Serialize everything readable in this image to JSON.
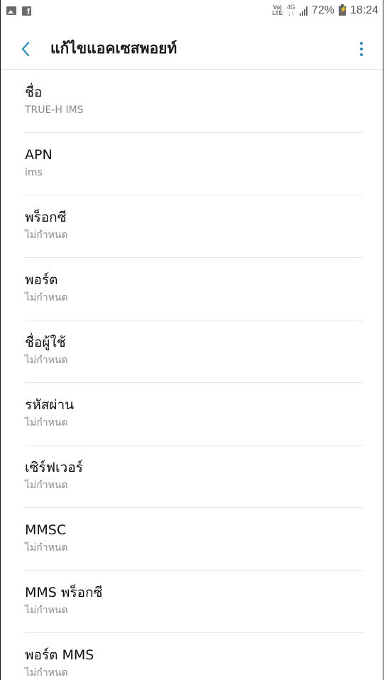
{
  "status_bar": {
    "volte_top": "Vo)",
    "volte_bottom": "LTE",
    "net_top": "4G",
    "net_bottom": "↓↑",
    "battery_percent": "72%",
    "time": "18:24",
    "left_icons": [
      "gallery-icon",
      "facebook-icon"
    ]
  },
  "toolbar": {
    "back_icon": "chevron-left-icon",
    "title": "แก้ไขแอคเซสพอยท์",
    "menu_icon": "more-vertical-icon",
    "accent_color": "#2e8bbd"
  },
  "fields": [
    {
      "key": "name",
      "label": "ชื่อ",
      "value": "TRUE-H IMS"
    },
    {
      "key": "apn",
      "label": "APN",
      "value": "ims"
    },
    {
      "key": "proxy",
      "label": "พร็อกซี",
      "value": "ไม่กำหนด"
    },
    {
      "key": "port",
      "label": "พอร์ต",
      "value": "ไม่กำหนด"
    },
    {
      "key": "username",
      "label": "ชื่อผู้ใช้",
      "value": "ไม่กำหนด"
    },
    {
      "key": "password",
      "label": "รหัสผ่าน",
      "value": "ไม่กำหนด"
    },
    {
      "key": "server",
      "label": "เซิร์ฟเวอร์",
      "value": "ไม่กำหนด"
    },
    {
      "key": "mmsc",
      "label": "MMSC",
      "value": "ไม่กำหนด"
    },
    {
      "key": "mms_proxy",
      "label": "MMS พร็อกซี",
      "value": "ไม่กำหนด"
    },
    {
      "key": "mms_port",
      "label": "พอร์ต MMS",
      "value": "ไม่กำหนด"
    }
  ]
}
